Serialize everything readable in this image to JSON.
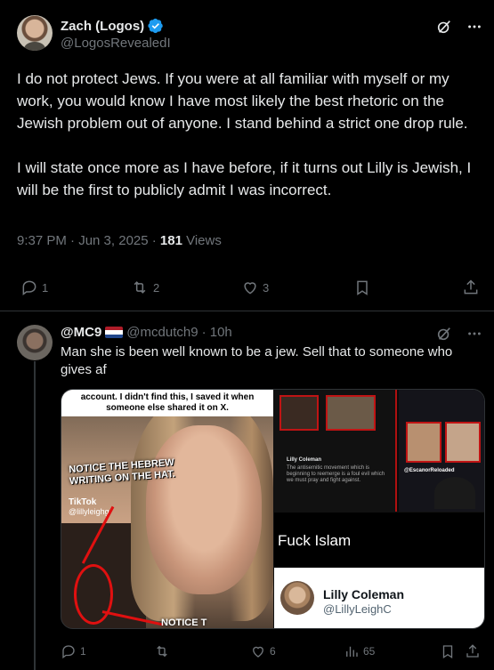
{
  "post": {
    "display_name": "Zach (Logos)",
    "handle": "@LogosRevealedI",
    "paragraphs": [
      "I do not protect Jews. If you were at all familiar with myself or my work, you would know I have most likely the best rhetoric on the Jewish problem out of anyone. I stand behind a strict one drop rule.",
      "I will state once more as I have before, if it turns out Lilly is Jewish, I will be the first to publicly admit I was incorrect."
    ],
    "timestamp": "9:37 PM · Jun 3, 2025 · ",
    "views_count": "181",
    "views_label": " Views",
    "replies": "1",
    "reposts": "2",
    "likes": "3"
  },
  "reply": {
    "display_name": "@MC9",
    "handle": "@mcdutch9",
    "time": " · 10h",
    "text": "Man she is been well known to be a jew. Sell that to someone who gives af",
    "replies": "1",
    "reposts": "",
    "likes": "6",
    "views": "65",
    "media": {
      "caption_top": "account. I didn't find this, I saved it when someone else shared it on X.",
      "notice_1": "NOTICE THE HEBREW WRITING ON THE HAT.",
      "notice_2": "NOTICE T",
      "tiktok_label": "TikTok",
      "tiktok_handle": "@lillyleighg",
      "panel_text": "Fuck Islam",
      "profile_name": "Lilly Coleman",
      "profile_handle": "@LillyLeighC",
      "escanor_tag": "@EscanorReloaded",
      "inner_name": "Lilly Coleman",
      "inner_text": "The antisemitic movement which is beginning to reemerge is a foul evil which we must pray and fight against."
    }
  },
  "colors": {
    "background": "#000000",
    "text": "#e7e9ea",
    "muted": "#71767b",
    "verified": "#1d9bf0",
    "divider": "#2f3336"
  },
  "icons": [
    "verified-badge-icon",
    "grok-icon",
    "more-icon",
    "reply-icon",
    "repost-icon",
    "like-icon",
    "bookmark-icon",
    "share-icon",
    "views-icon",
    "netherlands-flag-icon"
  ]
}
